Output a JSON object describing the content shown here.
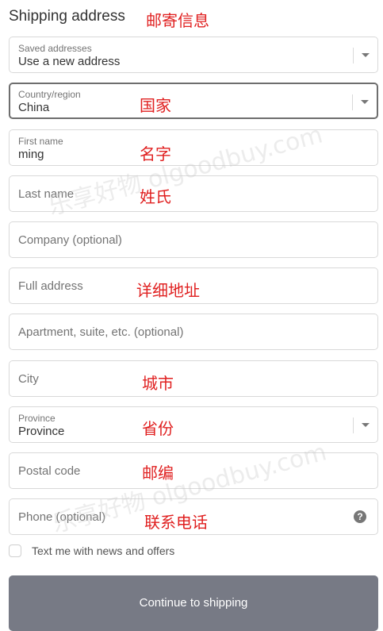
{
  "form": {
    "title": "Shipping address",
    "fields": {
      "saved": {
        "label": "Saved addresses",
        "value": "Use a new address"
      },
      "country": {
        "label": "Country/region",
        "value": "China"
      },
      "first_name": {
        "label": "First name",
        "value": "ming"
      },
      "last_name": {
        "placeholder": "Last name"
      },
      "company": {
        "placeholder": "Company (optional)"
      },
      "address": {
        "placeholder": "Full address"
      },
      "apartment": {
        "placeholder": "Apartment, suite, etc. (optional)"
      },
      "city": {
        "placeholder": "City"
      },
      "province": {
        "label": "Province",
        "value": "Province"
      },
      "postal": {
        "placeholder": "Postal code"
      },
      "phone": {
        "placeholder": "Phone (optional)"
      }
    },
    "newsletter_label": "Text me with news and offers",
    "continue_label": "Continue to shipping"
  },
  "annotations": {
    "title": "邮寄信息",
    "country": "国家",
    "first_name": "名字",
    "last_name": "姓氏",
    "address": "详细地址",
    "city": "城市",
    "province": "省份",
    "postal": "邮编",
    "phone": "联系电话"
  },
  "watermark": {
    "text1": "乐享好物 olgoodbuy.com",
    "text2": "乐享好物 olgoodbuy.com"
  },
  "colors": {
    "annotation": "#e02020",
    "button_bg": "#777a85"
  }
}
